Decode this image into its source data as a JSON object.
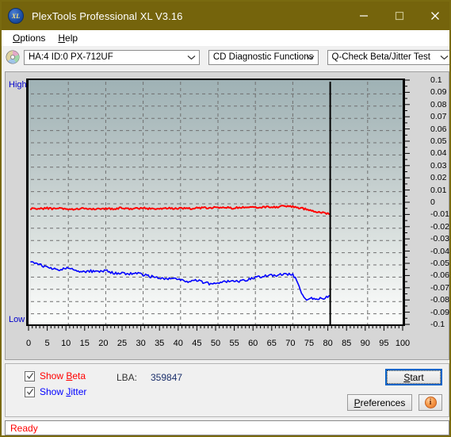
{
  "window": {
    "title": "PlexTools Professional XL V3.16",
    "icon": "XL",
    "minimize": "minimize-icon",
    "maximize": "maximize-icon",
    "close": "close-icon",
    "titlebar_color": "#75640c"
  },
  "menubar": {
    "items": [
      {
        "label": "Options",
        "mnemonic": "O"
      },
      {
        "label": "Help",
        "mnemonic": "H"
      }
    ]
  },
  "toolbar": {
    "disc_icon": "optical-disc-icon",
    "drive_select": {
      "value": "HA:4 ID:0  PX-712UF"
    },
    "function_select": {
      "value": "CD Diagnostic Functions"
    },
    "test_select": {
      "value": "Q-Check Beta/Jitter Test"
    }
  },
  "chart_axis": {
    "high_label": "High",
    "low_label": "Low",
    "y_ticks": [
      "0.1",
      "0.09",
      "0.08",
      "0.07",
      "0.06",
      "0.05",
      "0.04",
      "0.03",
      "0.02",
      "0.01",
      "0",
      "-0.01",
      "-0.02",
      "-0.03",
      "-0.04",
      "-0.05",
      "-0.06",
      "-0.07",
      "-0.08",
      "-0.09",
      "-0.1"
    ],
    "x_ticks": [
      "0",
      "5",
      "10",
      "15",
      "20",
      "25",
      "30",
      "35",
      "40",
      "45",
      "50",
      "55",
      "60",
      "65",
      "70",
      "75",
      "80",
      "85",
      "90",
      "95",
      "100"
    ]
  },
  "controls": {
    "show_beta": {
      "label": "Show Beta",
      "mnemonic": "B",
      "checked": true,
      "color": "#ff0000"
    },
    "show_jitter": {
      "label": "Show Jitter",
      "mnemonic": "J",
      "checked": true,
      "color": "#0000ff"
    },
    "lba_label": "LBA:",
    "lba_value": "359847",
    "start_button": "Start",
    "preferences_button": "Preferences",
    "info_button": "info-icon"
  },
  "statusbar": {
    "text": "Ready"
  },
  "chart_data": {
    "type": "line",
    "title": "Q-Check Beta/Jitter Test",
    "xlabel": "",
    "ylabel": "",
    "xlim": [
      0,
      100
    ],
    "ylim": [
      -0.1,
      0.1
    ],
    "grid": true,
    "legend_position": "below-left",
    "annotations": [
      {
        "type": "vline",
        "x": 80,
        "color": "#000000",
        "note": "end-of-data marker"
      },
      {
        "type": "axis-text",
        "text": "High",
        "position": "top-left",
        "color": "#0000cc"
      },
      {
        "type": "axis-text",
        "text": "Low",
        "position": "bottom-left",
        "color": "#0000cc"
      }
    ],
    "series": [
      {
        "name": "Beta",
        "color": "#ff0000",
        "x": [
          0,
          2,
          4,
          6,
          8,
          10,
          12,
          14,
          16,
          18,
          20,
          22,
          24,
          26,
          28,
          30,
          32,
          34,
          36,
          38,
          40,
          42,
          44,
          46,
          48,
          50,
          52,
          54,
          56,
          58,
          60,
          62,
          64,
          66,
          68,
          70,
          71,
          72,
          73,
          74,
          75,
          76,
          77,
          78,
          79,
          80
        ],
        "values": [
          -0.004,
          -0.004,
          -0.0035,
          -0.004,
          -0.0035,
          -0.004,
          -0.0045,
          -0.004,
          -0.004,
          -0.0045,
          -0.004,
          -0.004,
          -0.0035,
          -0.004,
          -0.004,
          -0.0035,
          -0.004,
          -0.004,
          -0.0035,
          -0.004,
          -0.0035,
          -0.004,
          -0.0035,
          -0.0035,
          -0.003,
          -0.0035,
          -0.003,
          -0.0035,
          -0.003,
          -0.003,
          -0.0025,
          -0.003,
          -0.0025,
          -0.0025,
          -0.002,
          -0.002,
          -0.003,
          -0.0035,
          -0.004,
          -0.005,
          -0.0055,
          -0.006,
          -0.007,
          -0.0075,
          -0.008,
          -0.0085
        ]
      },
      {
        "name": "Jitter",
        "color": "#0000ff",
        "x": [
          0,
          2,
          4,
          6,
          8,
          10,
          12,
          14,
          16,
          18,
          20,
          22,
          24,
          26,
          28,
          30,
          32,
          34,
          36,
          38,
          40,
          42,
          44,
          46,
          48,
          50,
          52,
          54,
          56,
          58,
          60,
          62,
          64,
          66,
          68,
          70,
          71,
          72,
          73,
          74,
          75,
          76,
          77,
          78,
          79,
          80
        ],
        "values": [
          -0.0465,
          -0.0495,
          -0.052,
          -0.0535,
          -0.054,
          -0.0525,
          -0.055,
          -0.0555,
          -0.055,
          -0.056,
          -0.0545,
          -0.0565,
          -0.057,
          -0.0575,
          -0.0565,
          -0.058,
          -0.0595,
          -0.0605,
          -0.0615,
          -0.061,
          -0.0625,
          -0.0635,
          -0.062,
          -0.0645,
          -0.0655,
          -0.065,
          -0.0635,
          -0.0625,
          -0.0635,
          -0.062,
          -0.0605,
          -0.0595,
          -0.0585,
          -0.0585,
          -0.0575,
          -0.0575,
          -0.063,
          -0.071,
          -0.0775,
          -0.078,
          -0.0775,
          -0.0785,
          -0.0775,
          -0.078,
          -0.0765,
          -0.0755
        ]
      }
    ]
  }
}
